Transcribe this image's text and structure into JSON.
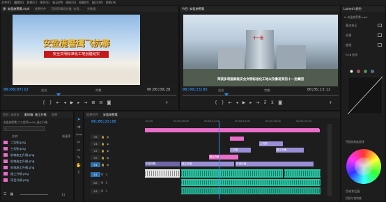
{
  "menu": [
    "文件(F)",
    "编辑(E)",
    "剪辑(C)",
    "序列(S)",
    "标记(M)",
    "图形(G)",
    "视图(V)",
    "窗口(W)",
    "帮助(H)"
  ],
  "source_panel": {
    "tabs": [
      "源: 安盈施警鹰.mp4",
      "效果控件",
      "音频剪辑混合器: 安盈...",
      "元数据"
    ],
    "video_title": "安盈施警鹰飞抗寨",
    "video_subtitle": "安全文明标准化工地创建纪实",
    "tc_left": "00;00;07;12",
    "fit": "适合",
    "quality": "完整",
    "tc_right": "00;00;09;28"
  },
  "program_panel": {
    "tab": "节目: 安盈施警鹰",
    "caption": "荣获多项国家级安全文明标准化工地以及鲁班奖的十一治集团",
    "tc_left": "00;00;23;05",
    "fit": "适合",
    "quality": "完整",
    "tc_right": "00;05;13;12",
    "building_sign": "十一治"
  },
  "project_panel": {
    "tabs": [
      "项目: 未命名",
      "素材箱: 施工升格",
      "效果"
    ],
    "path": "安盈施警鹰(丁工程师)mXX_施工升格",
    "search_placeholder": "",
    "col_name": "名称",
    "col_rate": "帧速率",
    "files": [
      "二切割.png",
      "三切割.png",
      "机电施工升格.png",
      "机电施工升格.png",
      "机电施工升格.png",
      "施工升格.png",
      "项目升格.png"
    ],
    "count": "11"
  },
  "timeline": {
    "tab": "安盈施警鹰",
    "tab2": "效果控件",
    "timecode": "00;00;23;05",
    "ruler": [
      "00;00",
      "00;00;05;00",
      "00;00;10;00",
      "00;00;15;00",
      "00;00;20;00",
      "00;00;25;00",
      "00;00;30;00"
    ],
    "tracks": [
      "V5",
      "V4",
      "V3",
      "V2",
      "V1",
      "A1",
      "A2",
      "A3"
    ],
    "clips": {
      "v1_a": "安盈施警...",
      "v1_b": "施工升格",
      "v1_c": "机电升格...",
      "v2_a": "施工升格",
      "v3_a": "二切割",
      "v3_b": "施工升格",
      "v4_a": "三切割"
    }
  },
  "lumetri": {
    "title": "Lumetri 颜色",
    "preset": "fx 安盈施警鹰.mp4",
    "rows": [
      "基本校正",
      "创意",
      "曲线",
      "RGB 曲线",
      "色相饱和度曲线"
    ],
    "wheels": "色轮和匹配",
    "hue_label": "色相与饱和度"
  },
  "colors": {
    "accent": "#2d8ceb",
    "clip_pink": "#e86ec7",
    "clip_violet": "#9a8fd6",
    "audio": "#2ebf9f"
  }
}
